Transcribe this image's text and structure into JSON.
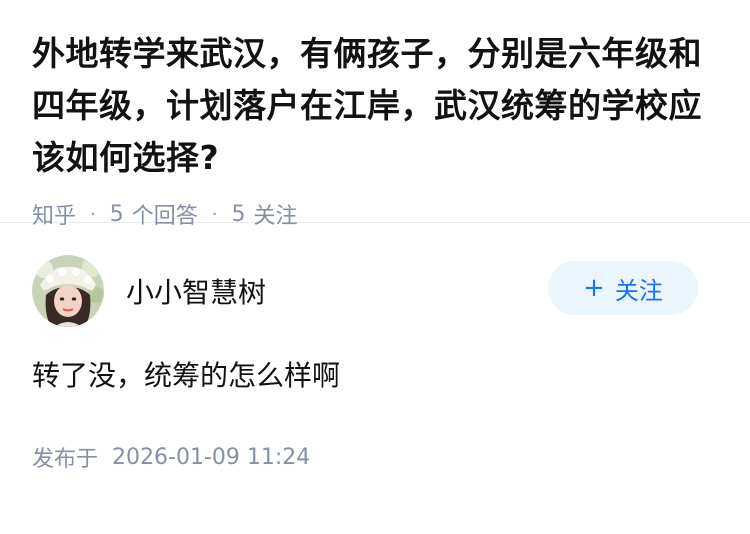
{
  "question": {
    "title": "外地转学来武汉，有俩孩子，分别是六年级和四年级，计划落户在江岸，武汉统筹的学校应该如何选择?",
    "meta": {
      "source": "知乎",
      "separator": "·",
      "answer_count": "5",
      "answer_label": "个回答",
      "follow_count": "5",
      "follow_label": "关注"
    }
  },
  "answer": {
    "author": {
      "name": "小小智慧树",
      "avatar_icon": "avatar-portrait-icon"
    },
    "follow_button": {
      "plus": "+",
      "label": "关注"
    },
    "content": "转了没，统筹的怎么样啊",
    "publish": {
      "label": "发布于",
      "datetime": "2026-01-09 11:24"
    }
  },
  "colors": {
    "text_primary": "#121212",
    "text_secondary": "#8590a6",
    "accent": "#1772f6",
    "button_bg": "#ebf5fd",
    "divider": "#f6f6f6"
  }
}
